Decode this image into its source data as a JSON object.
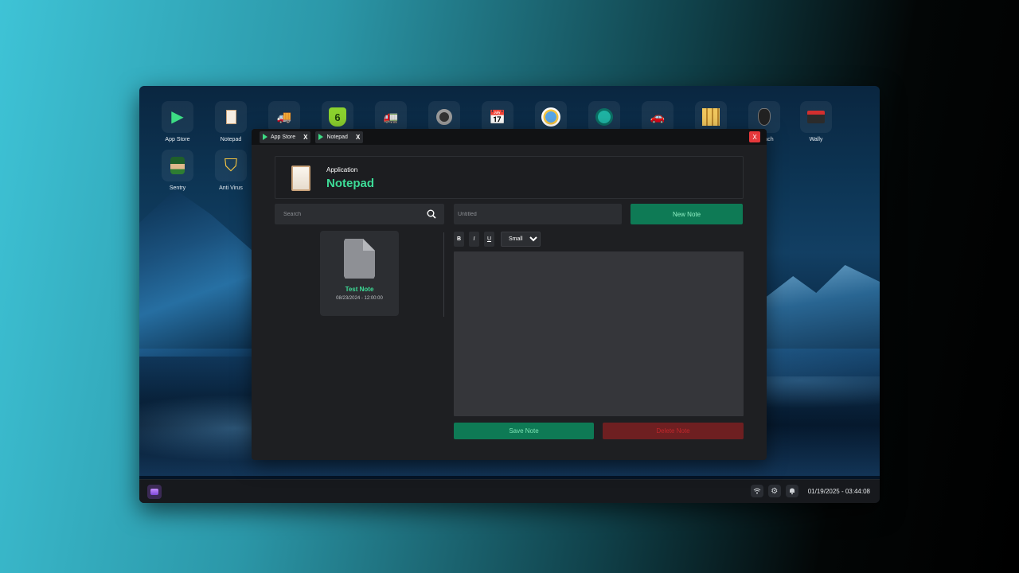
{
  "desktop": {
    "icons": [
      {
        "label": "App Store",
        "glyph": "▶",
        "color": "#3ddc84"
      },
      {
        "label": "Notepad",
        "glyph": "▯",
        "color": "#f4eadc"
      },
      {
        "label": "",
        "glyph": "🚚",
        "color": "#f5a623"
      },
      {
        "label": "",
        "glyph": "6",
        "color": "#9be23a"
      },
      {
        "label": "",
        "glyph": "🚛",
        "color": "#7ed321"
      },
      {
        "label": "",
        "glyph": "◎",
        "color": "#b0b0b0"
      },
      {
        "label": "",
        "glyph": "📅",
        "color": "#e74c3c"
      },
      {
        "label": "",
        "glyph": "◉",
        "color": "#f5c542"
      },
      {
        "label": "",
        "glyph": "◈",
        "color": "#2ec4b6"
      },
      {
        "label": "",
        "glyph": "🚗",
        "color": "#e53935"
      },
      {
        "label": "",
        "glyph": "▦",
        "color": "#f0c75e"
      },
      {
        "label": "ach",
        "glyph": "☗",
        "color": "#999"
      },
      {
        "label": "Wally",
        "glyph": "✉",
        "color": "#d32f2f"
      },
      {
        "label": "Sentry",
        "glyph": "☻",
        "color": "#43a047"
      },
      {
        "label": "Anti Virus",
        "glyph": "⛉",
        "color": "#f5c542"
      }
    ]
  },
  "window": {
    "tabs": [
      {
        "label": "App Store",
        "close": "X"
      },
      {
        "label": "Notepad",
        "close": "X"
      }
    ],
    "close_label": "X",
    "header": {
      "kicker": "Application",
      "title": "Notepad"
    },
    "search": {
      "placeholder": "Search"
    },
    "title_input": {
      "placeholder": "Untitled"
    },
    "new_note_label": "New Note",
    "notes": [
      {
        "name": "Test Note",
        "date": "08/23/2024 - 12:00:00"
      }
    ],
    "toolbar": {
      "bold": "B",
      "italic": "I",
      "underline": "U",
      "size_selected": "Small"
    },
    "save_label": "Save Note",
    "delete_label": "Delete Note"
  },
  "taskbar": {
    "clock": "01/19/2025 - 03:44:08",
    "tray_icons": [
      "wifi-icon",
      "gear-icon",
      "bell-icon"
    ]
  },
  "colors": {
    "accent": "#3ddc97",
    "button_green": "#0e7a55",
    "button_red": "#6e1f21",
    "close_red": "#e5383b"
  }
}
